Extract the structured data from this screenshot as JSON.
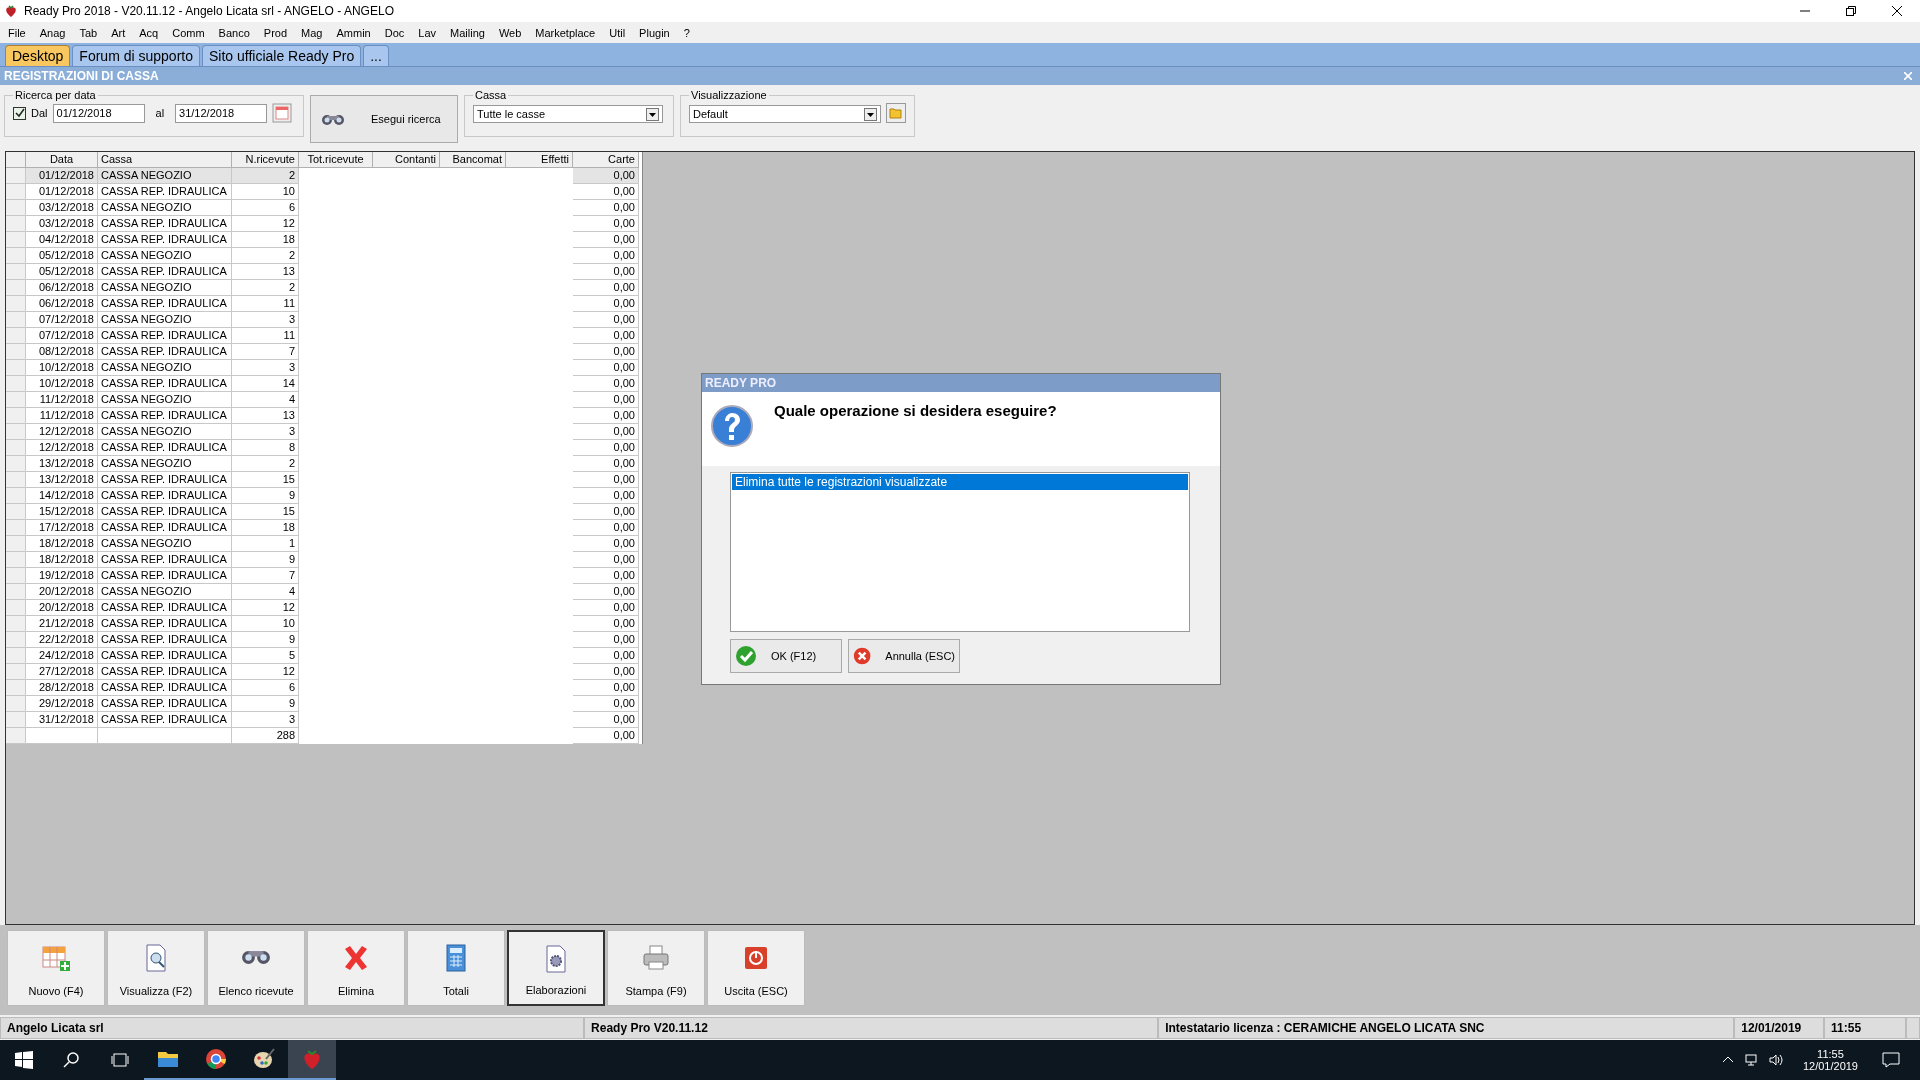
{
  "window": {
    "title": "Ready Pro 2018 - V20.11.12 - Angelo Licata srl - ANGELO - ANGELO"
  },
  "menu": [
    "File",
    "Anag",
    "Tab",
    "Art",
    "Acq",
    "Comm",
    "Banco",
    "Prod",
    "Mag",
    "Ammin",
    "Doc",
    "Lav",
    "Mailing",
    "Web",
    "Marketplace",
    "Util",
    "Plugin",
    "?"
  ],
  "tabs": [
    {
      "label": "Desktop",
      "selected": true
    },
    {
      "label": "Forum di supporto",
      "selected": false
    },
    {
      "label": "Sito ufficiale Ready Pro",
      "selected": false
    },
    {
      "label": "...",
      "selected": false
    }
  ],
  "section_title": "REGISTRAZIONI DI CASSA",
  "filters": {
    "date_group": "Ricerca per data",
    "from_label": "Dal",
    "from_checked": true,
    "from": "01/12/2018",
    "to_label": "al",
    "to": "31/12/2018",
    "search_button": "Esegui ricerca",
    "cassa_group": "Cassa",
    "cassa_value": "Tutte le casse",
    "view_group": "Visualizzazione",
    "view_value": "Default"
  },
  "table": {
    "columns": [
      "Data",
      "Cassa",
      "N.ricevute",
      "Tot.ricevute",
      "Contanti",
      "Bancomat",
      "Effetti",
      "Carte"
    ],
    "rows": [
      {
        "data": "01/12/2018",
        "cassa": "CASSA NEGOZIO",
        "n": "2",
        "carte": "0,00",
        "selected": true
      },
      {
        "data": "01/12/2018",
        "cassa": "CASSA REP. IDRAULICA",
        "n": "10",
        "carte": "0,00",
        "selected": false
      },
      {
        "data": "03/12/2018",
        "cassa": "CASSA NEGOZIO",
        "n": "6",
        "carte": "0,00",
        "selected": false
      },
      {
        "data": "03/12/2018",
        "cassa": "CASSA REP. IDRAULICA",
        "n": "12",
        "carte": "0,00",
        "selected": false
      },
      {
        "data": "04/12/2018",
        "cassa": "CASSA REP. IDRAULICA",
        "n": "18",
        "carte": "0,00",
        "selected": false
      },
      {
        "data": "05/12/2018",
        "cassa": "CASSA NEGOZIO",
        "n": "2",
        "carte": "0,00",
        "selected": false
      },
      {
        "data": "05/12/2018",
        "cassa": "CASSA REP. IDRAULICA",
        "n": "13",
        "carte": "0,00",
        "selected": false
      },
      {
        "data": "06/12/2018",
        "cassa": "CASSA NEGOZIO",
        "n": "2",
        "carte": "0,00",
        "selected": false
      },
      {
        "data": "06/12/2018",
        "cassa": "CASSA REP. IDRAULICA",
        "n": "11",
        "carte": "0,00",
        "selected": false
      },
      {
        "data": "07/12/2018",
        "cassa": "CASSA NEGOZIO",
        "n": "3",
        "carte": "0,00",
        "selected": false
      },
      {
        "data": "07/12/2018",
        "cassa": "CASSA REP. IDRAULICA",
        "n": "11",
        "carte": "0,00",
        "selected": false
      },
      {
        "data": "08/12/2018",
        "cassa": "CASSA REP. IDRAULICA",
        "n": "7",
        "carte": "0,00",
        "selected": false
      },
      {
        "data": "10/12/2018",
        "cassa": "CASSA NEGOZIO",
        "n": "3",
        "carte": "0,00",
        "selected": false
      },
      {
        "data": "10/12/2018",
        "cassa": "CASSA REP. IDRAULICA",
        "n": "14",
        "carte": "0,00",
        "selected": false
      },
      {
        "data": "11/12/2018",
        "cassa": "CASSA NEGOZIO",
        "n": "4",
        "carte": "0,00",
        "selected": false
      },
      {
        "data": "11/12/2018",
        "cassa": "CASSA REP. IDRAULICA",
        "n": "13",
        "carte": "0,00",
        "selected": false
      },
      {
        "data": "12/12/2018",
        "cassa": "CASSA NEGOZIO",
        "n": "3",
        "carte": "0,00",
        "selected": false
      },
      {
        "data": "12/12/2018",
        "cassa": "CASSA REP. IDRAULICA",
        "n": "8",
        "carte": "0,00",
        "selected": false
      },
      {
        "data": "13/12/2018",
        "cassa": "CASSA NEGOZIO",
        "n": "2",
        "carte": "0,00",
        "selected": false
      },
      {
        "data": "13/12/2018",
        "cassa": "CASSA REP. IDRAULICA",
        "n": "15",
        "carte": "0,00",
        "selected": false
      },
      {
        "data": "14/12/2018",
        "cassa": "CASSA REP. IDRAULICA",
        "n": "9",
        "carte": "0,00",
        "selected": false
      },
      {
        "data": "15/12/2018",
        "cassa": "CASSA REP. IDRAULICA",
        "n": "15",
        "carte": "0,00",
        "selected": false
      },
      {
        "data": "17/12/2018",
        "cassa": "CASSA REP. IDRAULICA",
        "n": "18",
        "carte": "0,00",
        "selected": false
      },
      {
        "data": "18/12/2018",
        "cassa": "CASSA NEGOZIO",
        "n": "1",
        "carte": "0,00",
        "selected": false
      },
      {
        "data": "18/12/2018",
        "cassa": "CASSA REP. IDRAULICA",
        "n": "9",
        "carte": "0,00",
        "selected": false
      },
      {
        "data": "19/12/2018",
        "cassa": "CASSA REP. IDRAULICA",
        "n": "7",
        "carte": "0,00",
        "selected": false
      },
      {
        "data": "20/12/2018",
        "cassa": "CASSA NEGOZIO",
        "n": "4",
        "carte": "0,00",
        "selected": false
      },
      {
        "data": "20/12/2018",
        "cassa": "CASSA REP. IDRAULICA",
        "n": "12",
        "carte": "0,00",
        "selected": false
      },
      {
        "data": "21/12/2018",
        "cassa": "CASSA REP. IDRAULICA",
        "n": "10",
        "carte": "0,00",
        "selected": false
      },
      {
        "data": "22/12/2018",
        "cassa": "CASSA REP. IDRAULICA",
        "n": "9",
        "carte": "0,00",
        "selected": false
      },
      {
        "data": "24/12/2018",
        "cassa": "CASSA REP. IDRAULICA",
        "n": "5",
        "carte": "0,00",
        "selected": false
      },
      {
        "data": "27/12/2018",
        "cassa": "CASSA REP. IDRAULICA",
        "n": "12",
        "carte": "0,00",
        "selected": false
      },
      {
        "data": "28/12/2018",
        "cassa": "CASSA REP. IDRAULICA",
        "n": "6",
        "carte": "0,00",
        "selected": false
      },
      {
        "data": "29/12/2018",
        "cassa": "CASSA REP. IDRAULICA",
        "n": "9",
        "carte": "0,00",
        "selected": false
      },
      {
        "data": "31/12/2018",
        "cassa": "CASSA REP. IDRAULICA",
        "n": "3",
        "carte": "0,00",
        "selected": false
      }
    ],
    "totals": {
      "n": "288",
      "carte": "0,00"
    }
  },
  "dialog": {
    "title": "READY PRO",
    "question": "Quale operazione si desidera eseguire?",
    "options": [
      {
        "label": "Elimina tutte le registrazioni visualizzate",
        "selected": true
      }
    ],
    "buttons": [
      {
        "label": "OK (F12)",
        "kind": "ok"
      },
      {
        "label": "Annulla (ESC)",
        "kind": "cancel"
      }
    ]
  },
  "toolbar": [
    {
      "label": "Nuovo (F4)",
      "kind": "new",
      "selected": false
    },
    {
      "label": "Visualizza (F2)",
      "kind": "view",
      "selected": false
    },
    {
      "label": "Elenco ricevute",
      "kind": "list",
      "selected": false
    },
    {
      "label": "Elimina",
      "kind": "delete",
      "selected": false
    },
    {
      "label": "Totali",
      "kind": "totals",
      "selected": false
    },
    {
      "label": "Elaborazioni",
      "kind": "process",
      "selected": true
    },
    {
      "label": "Stampa (F9)",
      "kind": "print",
      "selected": false
    },
    {
      "label": "Uscita (ESC)",
      "kind": "exit",
      "selected": false
    }
  ],
  "status_bar": [
    "Angelo Licata srl",
    "Ready Pro V20.11.12",
    "Intestatario licenza : CERAMICHE ANGELO LICATA SNC",
    "12/01/2019",
    "11:55"
  ],
  "taskbar": {
    "apps": [
      {
        "kind": "folder",
        "selected": false
      },
      {
        "kind": "browser",
        "selected": false
      },
      {
        "kind": "paint",
        "selected": false
      },
      {
        "kind": "app",
        "selected": true
      }
    ],
    "time": "11:55",
    "date": "12/01/2019"
  }
}
